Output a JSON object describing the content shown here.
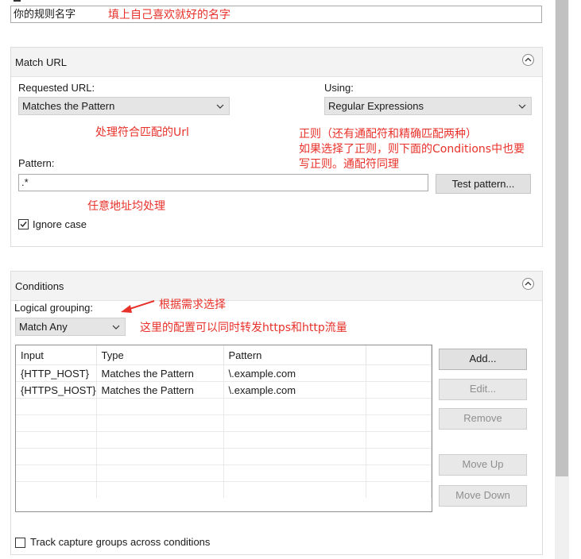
{
  "rule_name": {
    "value": "你的规则名字",
    "annotation": "填上自己喜欢就好的名字"
  },
  "match_url": {
    "title": "Match URL",
    "requested_url_label": "Requested URL:",
    "requested_url_value": "Matches the Pattern",
    "using_label": "Using:",
    "using_value": "Regular Expressions",
    "pattern_label": "Pattern:",
    "pattern_value": ".*",
    "test_pattern_button": "Test pattern...",
    "ignore_case_label": "Ignore case",
    "ignore_case_checked": true,
    "annotations": {
      "requested": "处理符合匹配的Url",
      "using_line1": "正则（还有通配符和精确匹配两种）",
      "using_line2": "如果选择了正则，则下面的Conditions中也要",
      "using_line3": "写正则。通配符同理",
      "pattern": "任意地址均处理"
    }
  },
  "conditions": {
    "title": "Conditions",
    "logical_grouping_label": "Logical grouping:",
    "logical_grouping_value": "Match Any",
    "annotation_grouping": "根据需求选择",
    "annotation_match_any": "这里的配置可以同时转发https和http流量",
    "columns": [
      "Input",
      "Type",
      "Pattern"
    ],
    "rows": [
      [
        "{HTTP_HOST}",
        "Matches the Pattern",
        "\\.example.com"
      ],
      [
        "{HTTPS_HOST}",
        "Matches the Pattern",
        "\\.example.com"
      ]
    ],
    "buttons": {
      "add": "Add...",
      "edit": "Edit...",
      "remove": "Remove",
      "move_up": "Move Up",
      "move_down": "Move Down"
    },
    "track_label": "Track capture groups across conditions",
    "track_checked": false
  },
  "colors": {
    "annotation": "#e8312a",
    "panel_header": "#f3f3f3",
    "button": "#e1e1e1"
  }
}
